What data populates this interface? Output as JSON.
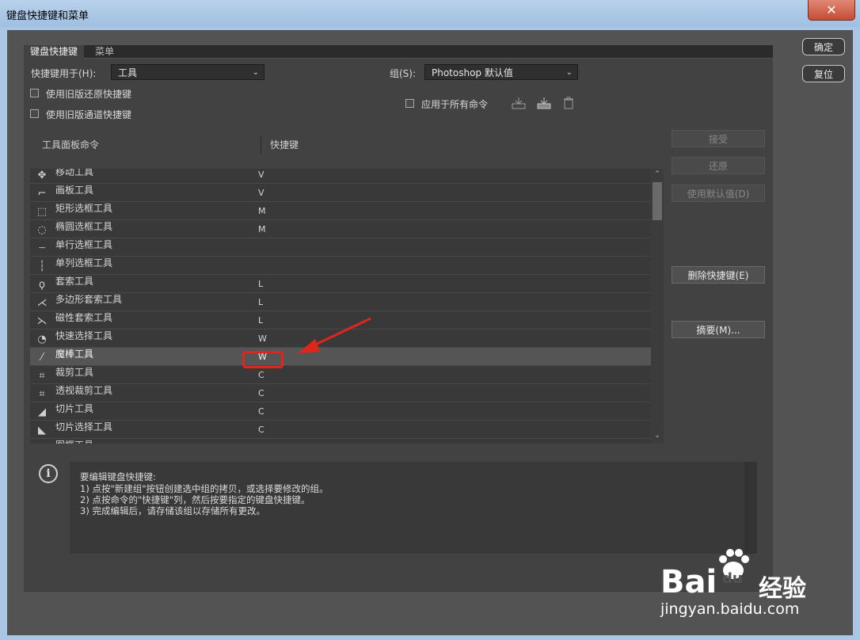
{
  "window": {
    "title": "键盘快捷键和菜单",
    "close_label": "✕"
  },
  "tabs": [
    {
      "label": "键盘快捷键",
      "active": true
    },
    {
      "label": "菜单",
      "active": false
    }
  ],
  "shortcuts_for": {
    "label": "快捷键用于(H):",
    "value": "工具"
  },
  "group": {
    "label": "组(S):",
    "value": "Photoshop 默认值"
  },
  "checkboxes": {
    "legacy_undo": "使用旧版还原快捷键",
    "legacy_channel": "使用旧版通道快捷键",
    "apply_all": "应用于所有命令"
  },
  "table": {
    "col_command": "工具面板命令",
    "col_shortcut": "快捷键",
    "rows": [
      {
        "icon": "move-tool-icon",
        "glyph": "✥",
        "name": "移动工具",
        "key": "V"
      },
      {
        "icon": "artboard-tool-icon",
        "glyph": "⌐",
        "name": "画板工具",
        "key": "V"
      },
      {
        "icon": "rect-marquee-icon",
        "glyph": "⬚",
        "name": "矩形选框工具",
        "key": "M"
      },
      {
        "icon": "ellipse-marquee-icon",
        "glyph": "◌",
        "name": "椭圆选框工具",
        "key": "M"
      },
      {
        "icon": "single-row-marquee-icon",
        "glyph": "┄",
        "name": "单行选框工具",
        "key": ""
      },
      {
        "icon": "single-column-marquee-icon",
        "glyph": "┆",
        "name": "单列选框工具",
        "key": ""
      },
      {
        "icon": "lasso-tool-icon",
        "glyph": "ϙ",
        "name": "套索工具",
        "key": "L"
      },
      {
        "icon": "polygon-lasso-icon",
        "glyph": "⋌",
        "name": "多边形套索工具",
        "key": "L"
      },
      {
        "icon": "magnetic-lasso-icon",
        "glyph": "⋋",
        "name": "磁性套索工具",
        "key": "L"
      },
      {
        "icon": "quick-selection-icon",
        "glyph": "◔",
        "name": "快速选择工具",
        "key": "W"
      },
      {
        "icon": "magic-wand-icon",
        "glyph": "⁄",
        "name": "魔棒工具",
        "key": "W",
        "selected": true
      },
      {
        "icon": "crop-tool-icon",
        "glyph": "⌗",
        "name": "裁剪工具",
        "key": "C"
      },
      {
        "icon": "perspective-crop-icon",
        "glyph": "⌗",
        "name": "透视裁剪工具",
        "key": "C"
      },
      {
        "icon": "slice-tool-icon",
        "glyph": "◢",
        "name": "切片工具",
        "key": "C"
      },
      {
        "icon": "slice-select-icon",
        "glyph": "◣",
        "name": "切片选择工具",
        "key": "C"
      },
      {
        "icon": "frame-tool-icon",
        "glyph": "▭",
        "name": "图框工具",
        "key": ""
      }
    ]
  },
  "buttons": {
    "ok": "确定",
    "reset": "复位",
    "accept": "接受",
    "undo": "还原",
    "use_default": "使用默认值(D)",
    "delete_shortcut": "删除快捷键(E)",
    "summarize": "摘要(M)..."
  },
  "info": {
    "lines": [
      "要编辑键盘快捷键:",
      "1) 点按\"新建组\"按钮创建选中组的拷贝，或选择要修改的组。",
      "2) 点按命令的\"快捷键\"列，然后按要指定的键盘快捷键。",
      "3) 完成编辑后，请存储该组以存储所有更改。"
    ]
  },
  "watermark": {
    "brand": "Bai",
    "brand2": "du",
    "cn": "经验",
    "url": "jingyan.baidu.com"
  },
  "colors": {
    "annotation": "#e0251c",
    "panel": "#424242"
  }
}
